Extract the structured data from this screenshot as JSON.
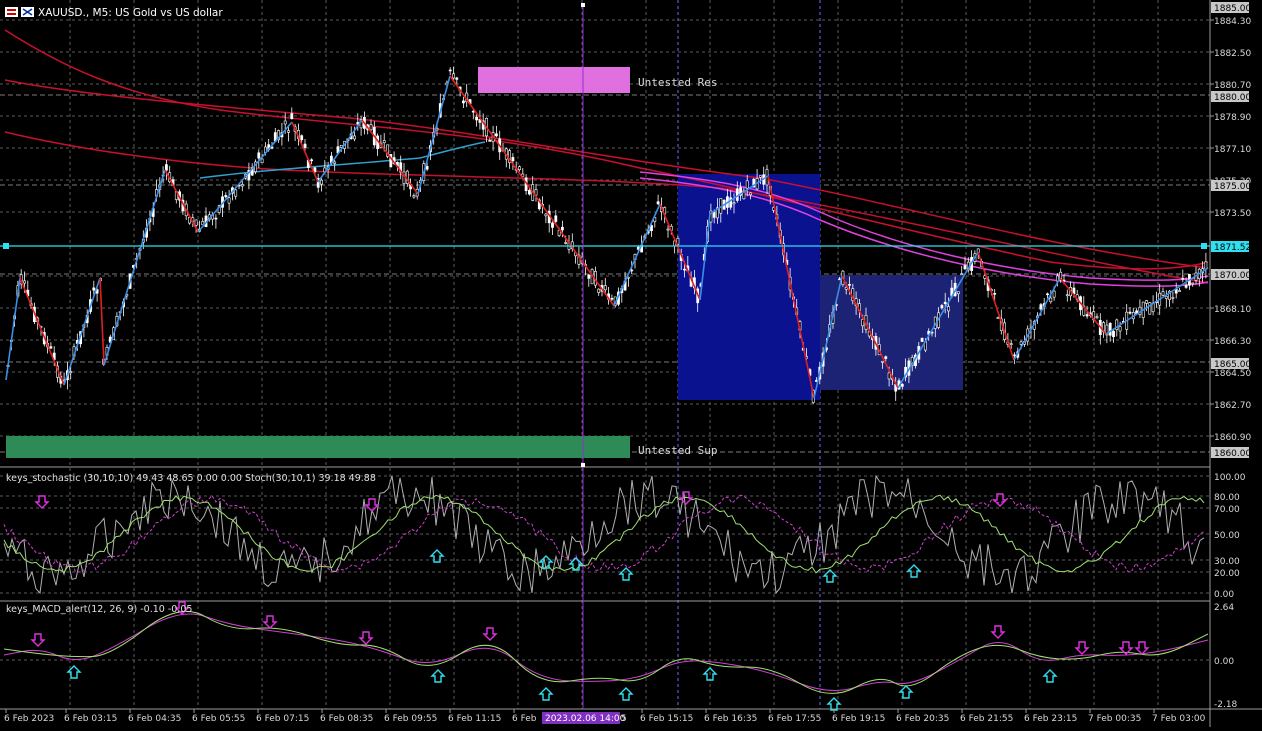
{
  "window": {
    "symbol_label": "XAUUSD., M5:  US Gold vs US dollar"
  },
  "colors": {
    "background": "#000000",
    "grid": "#5a5a5a",
    "bull_candle": "#ffffff",
    "bear_candle": "#ffffff",
    "zigzag_up": "#3a8ee6",
    "zigzag_down": "#e02020",
    "ma_red": "#c8102e",
    "ma_magenta": "#e040e0",
    "ma_cyan": "#30a0d0",
    "bid_line": "#30e0f0",
    "resistance_zone": "#e070e0",
    "support_zone": "#2e8b57",
    "box_dark": "#0a128f",
    "box_light": "#1c2375",
    "stoch_main": "#b0b0b0",
    "stoch_signal": "#d040d0",
    "stoch_smooth": "#a0e070",
    "macd_main": "#d040d0",
    "macd_signal": "#a0e070",
    "arrow_down": "#e030e0",
    "arrow_up": "#30e0f0",
    "selected_vline": "#9030d0",
    "price_label_bg": "#ffffff"
  },
  "zones": {
    "resistance_label": "Untested Res",
    "support_label": "Untested Sup"
  },
  "price_axis": {
    "labels": [
      "1884.30",
      "1882.50",
      "1880.70",
      "1878.90",
      "1877.10",
      "1875.30",
      "1873.50",
      "1868.10",
      "1866.30",
      "1864.50",
      "1862.70",
      "1860.90"
    ],
    "boxed_labels": [
      "1885.00",
      "1880.00",
      "1875.00",
      "1870.00",
      "1865.00",
      "1860.00"
    ],
    "bid_label": "1871.52",
    "range": [
      1859.4,
      1885.5
    ]
  },
  "stochastic": {
    "header": "keys_stochastic (30,10,10) 49.43 48.65 0.00 0.00 Stoch(30,10,1) 39.18 49.88",
    "levels": [
      "100.00",
      "80.00",
      "70.00",
      "50.00",
      "30.00",
      "20.00",
      "0.00"
    ]
  },
  "macd": {
    "header": "keys_MACD_alert(12, 26, 9) -0.10 -0.05",
    "levels": [
      "2.64",
      "0.00",
      "-2.18"
    ]
  },
  "time_axis": {
    "labels": [
      "6 Feb 2023",
      "6 Feb 03:15",
      "6 Feb 04:35",
      "6 Feb 05:55",
      "6 Feb 07:15",
      "6 Feb 08:35",
      "6 Feb 09:55",
      "6 Feb 11:15",
      "6 Feb",
      "6 Feb 15:15",
      "6 Feb 16:35",
      "6 Feb 17:55",
      "6 Feb 19:15",
      "6 Feb 20:35",
      "6 Feb 21:55",
      "6 Feb 23:15",
      "7 Feb 00:35",
      "7 Feb 03:00"
    ],
    "cursor_label": "2023.02.06 14:00",
    "cursor_tail": "5"
  }
}
